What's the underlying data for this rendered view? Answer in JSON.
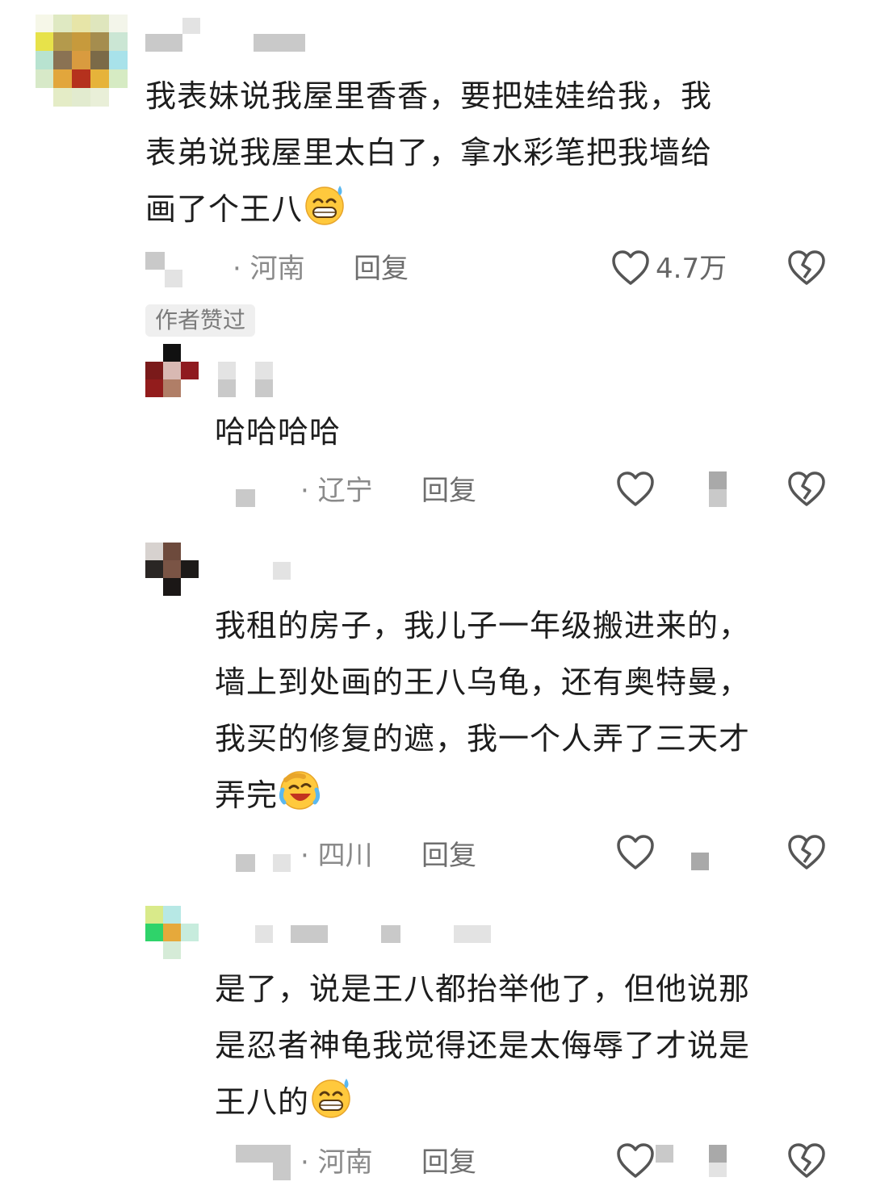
{
  "comments": [
    {
      "text": "我表妹说我屋里香香，要把娃娃给我，我表弟说我屋里太白了，拿水彩笔把我墙给画了个王八",
      "line1": "我表妹说我屋里香香，要把娃娃给我，我",
      "line2": "表弟说我屋里太白了，拿水彩笔把我墙给",
      "line3": "画了个王八",
      "emoji": "grinning-sweat-emoji",
      "location": "· 河南",
      "reply_label": "回复",
      "like_count": "4.7万",
      "badge": "作者赞过"
    },
    {
      "text": "哈哈哈哈",
      "location": "· 辽宁",
      "reply_label": "回复"
    },
    {
      "text": "我租的房子，我儿子一年级搬进来的，墙上到处画的王八乌龟，还有奥特曼，我买的修复的遮，我一个人弄了三天才弄完",
      "line1": "我租的房子，我儿子一年级搬进来的，",
      "line2": "墙上到处画的王八乌龟，还有奥特曼，",
      "line3": "我买的修复的遮，我一个人弄了三天才",
      "line4": "弄完",
      "emoji": "crying-laughing-emoji",
      "location": "· 四川",
      "reply_label": "回复"
    },
    {
      "text": "是了，说是王八都抬举他了，但他说那是忍者神龟我觉得还是太侮辱了才说是王八的",
      "line1": "是了，说是王八都抬举他了，但他说那",
      "line2": "是忍者神龟我觉得还是太侮辱了才说是",
      "line3": "王八的",
      "emoji": "grinning-sweat-emoji",
      "location": "· 河南",
      "reply_label": "回复"
    }
  ],
  "icons": {
    "like": "heart-outline-icon",
    "dislike": "broken-heart-icon"
  },
  "colors": {
    "text": "#1d1d1d",
    "meta": "#8a8a8a",
    "icon": "#555555",
    "badge_bg": "#efefef"
  }
}
